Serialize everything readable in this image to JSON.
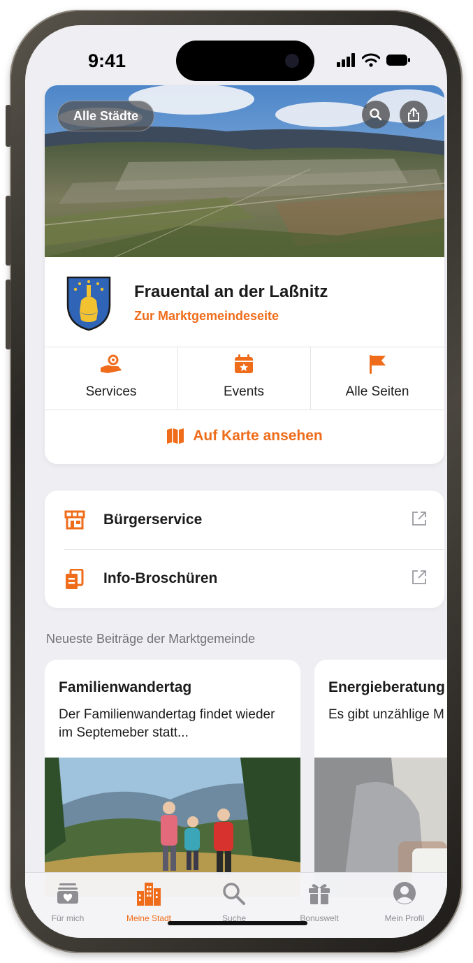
{
  "status_bar": {
    "time": "9:41"
  },
  "hero": {
    "all_cities_label": "Alle Städte",
    "search_icon": "search-icon",
    "share_icon": "share-icon",
    "town_name": "Frauental an der Laßnitz",
    "town_link": "Zur Marktgemeindeseite"
  },
  "quick_links": [
    {
      "label": "Services",
      "icon": "hand-gear-icon"
    },
    {
      "label": "Events",
      "icon": "calendar-star-icon"
    },
    {
      "label": "Alle Seiten",
      "icon": "flag-icon"
    }
  ],
  "map_link": {
    "label": "Auf Karte ansehen",
    "icon": "map-icon"
  },
  "list": [
    {
      "label": "Bürgerservice",
      "icon": "storefront-icon"
    },
    {
      "label": "Info-Broschüren",
      "icon": "documents-icon"
    }
  ],
  "section_title": "Neueste Beiträge der Marktgemeinde",
  "news": [
    {
      "title": "Familienwandertag",
      "text": "Der Familienwandertag findet wieder im Septemeber statt..."
    },
    {
      "title": "Energieberatung",
      "text": "Es gibt unzählige M Energie und damit"
    }
  ],
  "tabs": [
    {
      "label": "Für mich",
      "icon": "inbox-heart-icon",
      "active": false
    },
    {
      "label": "Meine Stadt",
      "icon": "city-buildings-icon",
      "active": true
    },
    {
      "label": "Suche",
      "icon": "search-icon",
      "active": false
    },
    {
      "label": "Bonuswelt",
      "icon": "gift-icon",
      "active": false
    },
    {
      "label": "Mein Profil",
      "icon": "profile-icon",
      "active": false
    }
  ],
  "colors": {
    "accent": "#ef6c1b",
    "background": "#efeff3",
    "card": "#ffffff",
    "text": "#1b1b1b",
    "muted": "#8e8e93"
  }
}
